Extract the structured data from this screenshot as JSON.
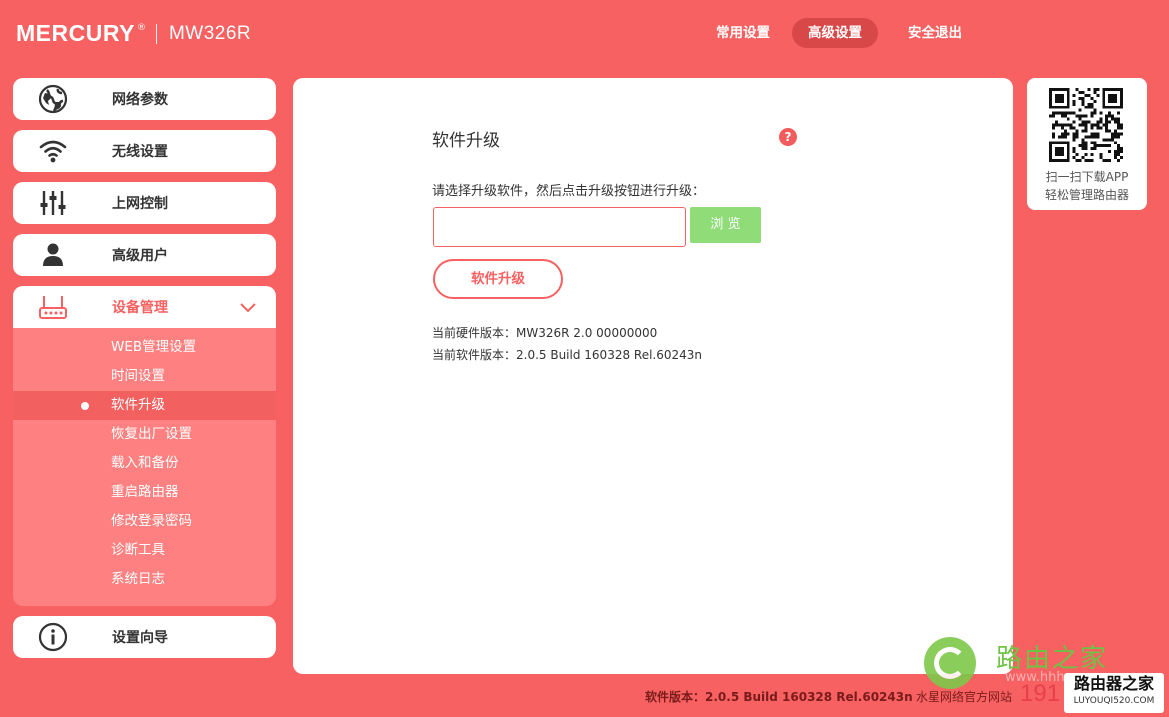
{
  "header": {
    "brand": "MERCURY",
    "reg": "®",
    "model": "MW326R",
    "tabs": [
      {
        "label": "常用设置",
        "active": false
      },
      {
        "label": "高级设置",
        "active": true
      },
      {
        "label": "安全退出",
        "active": false
      }
    ]
  },
  "sidebar": {
    "items": [
      {
        "label": "网络参数",
        "icon": "globe-icon"
      },
      {
        "label": "无线设置",
        "icon": "wifi-icon"
      },
      {
        "label": "上网控制",
        "icon": "sliders-icon"
      },
      {
        "label": "高级用户",
        "icon": "user-icon"
      },
      {
        "label": "设备管理",
        "icon": "router-icon",
        "expanded": true
      },
      {
        "label": "设置向导",
        "icon": "info-icon"
      }
    ],
    "submenu": [
      {
        "label": "WEB管理设置",
        "active": false
      },
      {
        "label": "时间设置",
        "active": false
      },
      {
        "label": "软件升级",
        "active": true
      },
      {
        "label": "恢复出厂设置",
        "active": false
      },
      {
        "label": "载入和备份",
        "active": false
      },
      {
        "label": "重启路由器",
        "active": false
      },
      {
        "label": "修改登录密码",
        "active": false
      },
      {
        "label": "诊断工具",
        "active": false
      },
      {
        "label": "系统日志",
        "active": false
      }
    ]
  },
  "main": {
    "title": "软件升级",
    "help": "?",
    "instruction": "请选择升级软件，然后点击升级按钮进行升级：",
    "file_value": "",
    "browse_label": "浏 览",
    "upgrade_label": "软件升级",
    "hw_version": "当前硬件版本：MW326R 2.0 00000000",
    "sw_version": "当前软件版本：2.0.5 Build 160328 Rel.60243n"
  },
  "qr": {
    "line1": "扫一扫下载APP",
    "line2": "轻松管理路由器"
  },
  "footer": {
    "version": "软件版本：2.0.5 Build 160328 Rel.60243n",
    "site_link": "水星网络官方网站"
  },
  "watermark": {
    "text1": "路由之家",
    "text2": "www.hhh...",
    "num": "191",
    "badge1": "路由器之家",
    "badge2": "LUYOUQI520.COM"
  },
  "colors": {
    "background": "#f76161",
    "accent": "#f76161",
    "browse_green": "#8fdc78",
    "active_tab": "#d94848"
  }
}
